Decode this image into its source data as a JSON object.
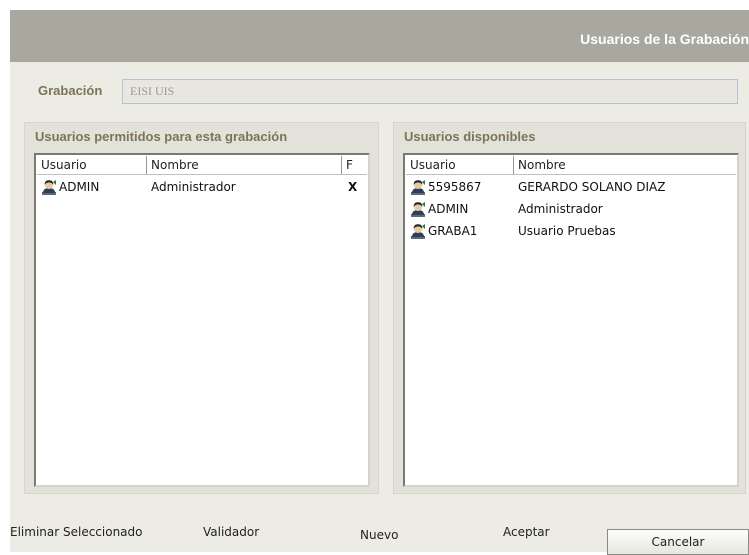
{
  "window": {
    "title": "Usuarios de la Grabación"
  },
  "grabacion": {
    "label": "Grabación",
    "value": "EISI UIS"
  },
  "left_panel": {
    "title": "Usuarios permitidos para esta grabación",
    "columns": [
      "Usuario",
      "Nombre",
      "F"
    ],
    "rows": [
      {
        "usuario": "ADMIN",
        "nombre": "Administrador",
        "f": "X"
      }
    ]
  },
  "right_panel": {
    "title": "Usuarios disponibles",
    "columns": [
      "Usuario",
      "Nombre"
    ],
    "rows": [
      {
        "usuario": "5595867",
        "nombre": "GERARDO SOLANO DIAZ"
      },
      {
        "usuario": "ADMIN",
        "nombre": "Administrador"
      },
      {
        "usuario": "GRABA1",
        "nombre": "Usuario Pruebas"
      }
    ]
  },
  "buttons": {
    "eliminar": "Eliminar Seleccionado",
    "validador": "Validador",
    "nuevo": "Nuevo",
    "aceptar": "Aceptar",
    "cancelar": "Cancelar"
  },
  "icons": {
    "user_row": "user-icon"
  },
  "colors": {
    "title_bar": "#a9a89f",
    "label_text": "#7d7456",
    "window_bg": "#ecebe4"
  }
}
